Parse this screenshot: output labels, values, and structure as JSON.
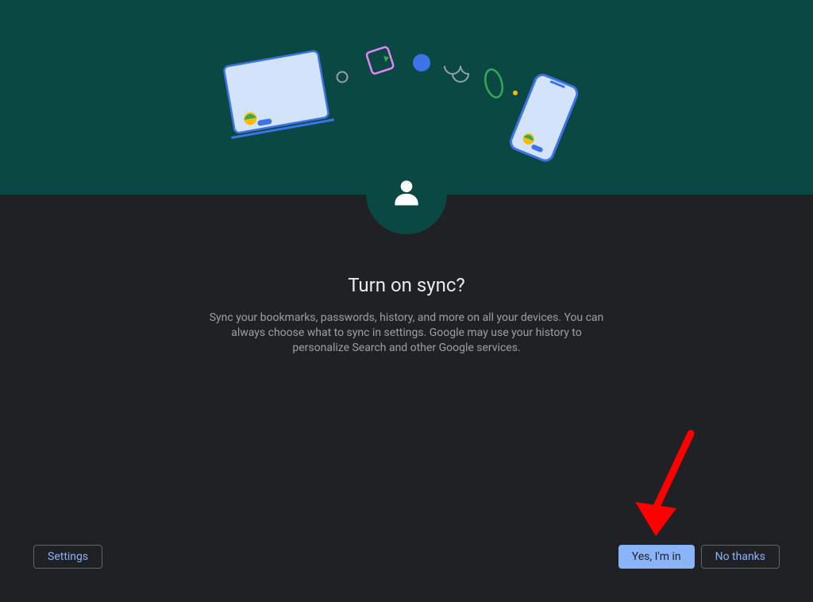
{
  "dialog": {
    "title": "Turn on sync?",
    "description": "Sync your bookmarks, passwords, history, and more on all your devices. You can always choose what to sync in settings. Google may use your history to personalize Search and other Google services."
  },
  "buttons": {
    "settings": "Settings",
    "yes": "Yes, I'm in",
    "no": "No thanks"
  },
  "colors": {
    "hero_bg": "#0a4844",
    "body_bg": "#202124",
    "accent": "#8ab4f8",
    "arrow": "#ff0000"
  }
}
